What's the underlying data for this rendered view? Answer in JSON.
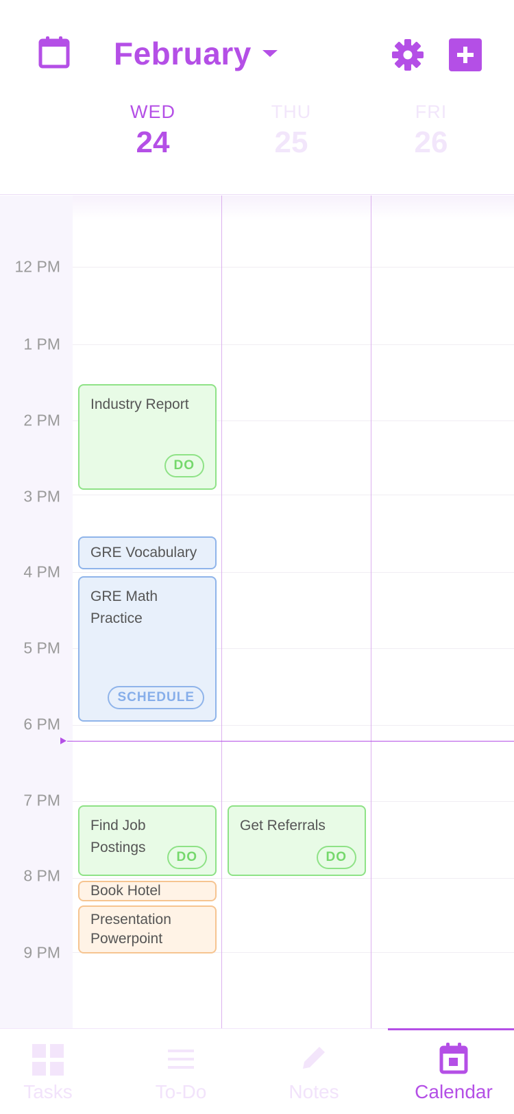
{
  "header": {
    "month": "February",
    "days": [
      {
        "dow": "WED",
        "date": "24"
      },
      {
        "dow": "THU",
        "date": "25"
      },
      {
        "dow": "FRI",
        "date": "26"
      }
    ]
  },
  "time_labels": [
    "12 PM",
    "1 PM",
    "2 PM",
    "3 PM",
    "4 PM",
    "5 PM",
    "6 PM",
    "7 PM",
    "8 PM",
    "9 PM"
  ],
  "events": [
    {
      "day": "WED",
      "title": "Industry Report",
      "tag": "DO",
      "category": "green"
    },
    {
      "day": "WED",
      "title": "GRE Vocabulary",
      "category": "blue"
    },
    {
      "day": "WED",
      "title": "GRE Math Practice",
      "tag": "SCHEDULE",
      "category": "blue"
    },
    {
      "day": "WED",
      "title": "Find Job Postings",
      "tag": "DO",
      "category": "green"
    },
    {
      "day": "WED",
      "title": "Book Hotel",
      "category": "orange"
    },
    {
      "day": "WED",
      "title": "Presentation Powerpoint",
      "category": "orange"
    },
    {
      "day": "THU",
      "title": "Get Referrals",
      "tag": "DO",
      "category": "green"
    }
  ],
  "nav": [
    {
      "label": "Tasks",
      "icon": "grid-icon"
    },
    {
      "label": "To-Do",
      "icon": "list-icon"
    },
    {
      "label": "Notes",
      "icon": "pencil-icon"
    },
    {
      "label": "Calendar",
      "icon": "calendar-icon",
      "active": true
    }
  ],
  "colors": {
    "accent": "#b44fe6",
    "do_green": "#8ee286",
    "schedule_blue": "#8fb4ea",
    "orange": "#f6c490"
  }
}
